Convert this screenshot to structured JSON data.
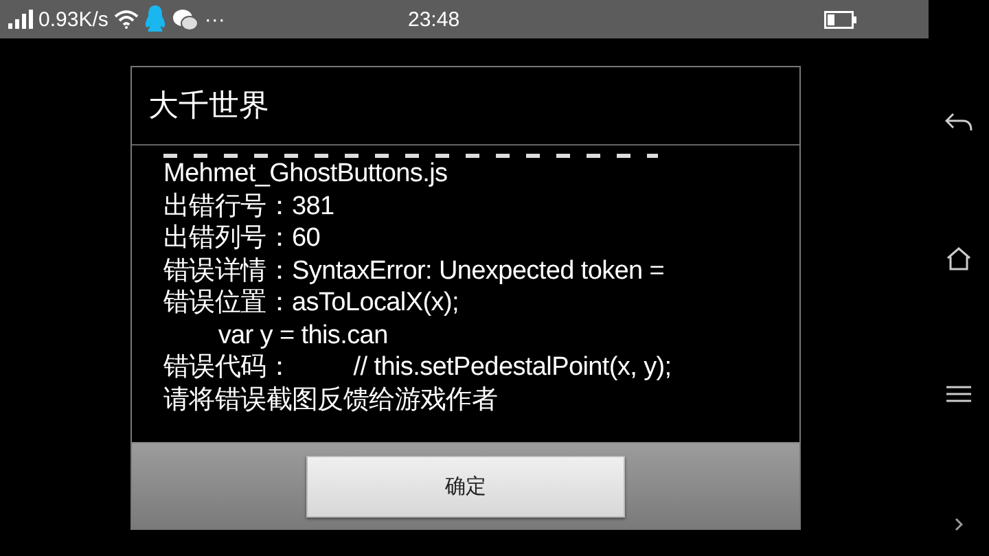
{
  "status_bar": {
    "speed": "0.93K/s",
    "more": "···",
    "time": "23:48"
  },
  "dialog": {
    "title": "大千世界",
    "lines": [
      "Mehmet_GhostButtons.js",
      "出错行号：381",
      "出错列号：60",
      "错误详情：SyntaxError: Unexpected token =",
      "错误位置：asToLocalX(x);",
      "        var y = this.can",
      "错误代码：         // this.setPedestalPoint(x, y);",
      "请将错误截图反馈给游戏作者"
    ],
    "button": "确定"
  }
}
